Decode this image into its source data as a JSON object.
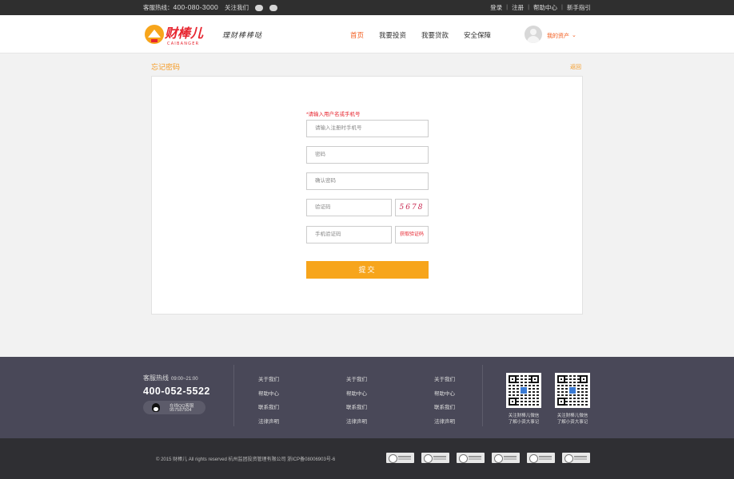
{
  "topbar": {
    "hotline_label": "客服热线：",
    "hotline_number": "400-080-3000",
    "follow_label": "关注我们",
    "links": [
      "登录",
      "注册",
      "帮助中心",
      "新手指引"
    ],
    "separator": "|"
  },
  "header": {
    "logo_text": "财棒儿",
    "logo_sub": "CAIBANGER",
    "slogan": "理财棒棒哒",
    "nav": [
      "首页",
      "我要投资",
      "我要贷款",
      "安全保障"
    ],
    "nav_active": 0,
    "my_assets": "我的资产",
    "chevron": "⌄"
  },
  "page": {
    "title": "忘记密码",
    "back": "返回"
  },
  "form": {
    "hint": "*请输入用户名或手机号",
    "username_placeholder": "请输入注册时手机号",
    "password_placeholder": "密码",
    "confirm_placeholder": "确认密码",
    "captcha_placeholder": "验证码",
    "captcha_value": "5678",
    "sms_placeholder": "手机验证码",
    "get_code": "获取验证码",
    "submit": "提交"
  },
  "footer": {
    "hotline_label": "客服热线",
    "hotline_hours": "09:00~21:00",
    "phone": "400-052-5522",
    "qq_label": "在线QQ客服",
    "qq_number": "957587504",
    "columns": [
      [
        "关于我们",
        "帮助中心",
        "联系我们",
        "法律声明"
      ],
      [
        "关于我们",
        "帮助中心",
        "联系我们",
        "法律声明"
      ],
      [
        "关于我们",
        "帮助中心",
        "联系我们",
        "法律声明"
      ]
    ],
    "qr_captions": [
      [
        "关注财棒儿微信",
        "了解小资大事记"
      ],
      [
        "关注财棒儿微信",
        "了解小资大事记"
      ]
    ]
  },
  "bottom": {
    "copyright": "© 2015 财棒儿 All rights reserved 杭州监团投资管理有限公司 浙ICP备08006903号-6",
    "badge_count": 6
  },
  "colors": {
    "accent": "#f25c1d",
    "button": "#f7a51b",
    "footer_bg": "#494858",
    "bar_bg": "#2f2f2f"
  }
}
